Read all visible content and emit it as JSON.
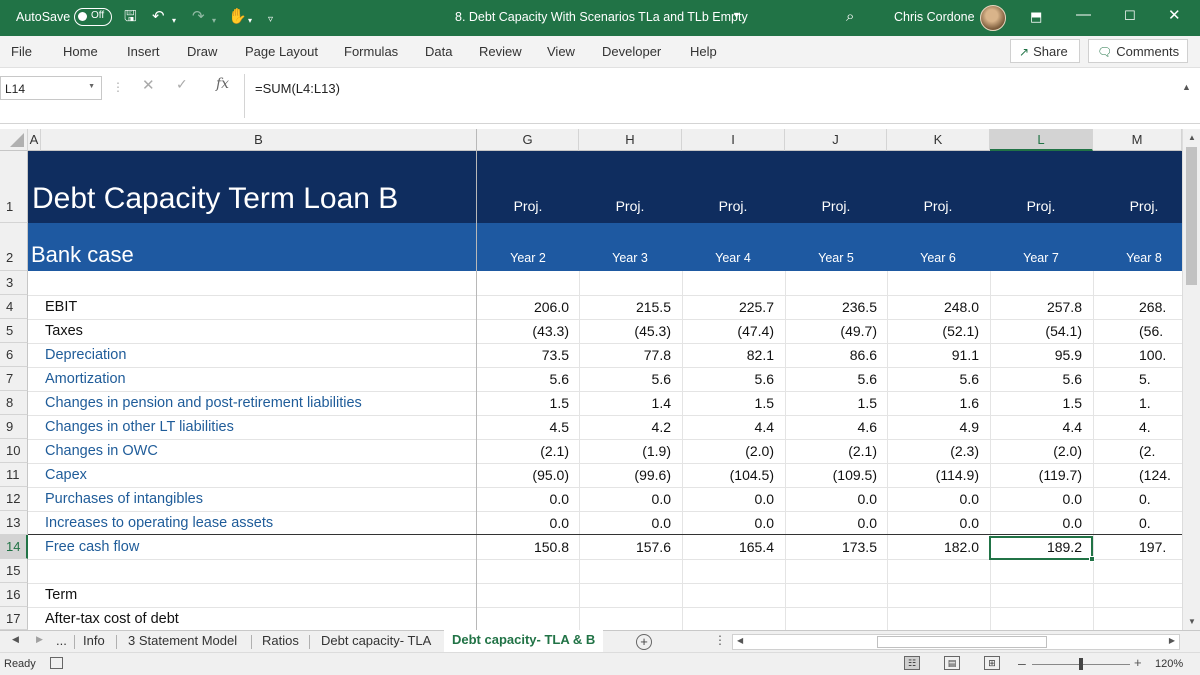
{
  "titlebar": {
    "autosave_label": "AutoSave",
    "autosave_state": "Off",
    "doc_title": "8. Debt Capacity With Scenarios TLa and TLb Empty",
    "user_name": "Chris Cordone",
    "bg_color": "#217346"
  },
  "ribbon": {
    "tabs": [
      "File",
      "Home",
      "Insert",
      "Draw",
      "Page Layout",
      "Formulas",
      "Data",
      "Review",
      "View",
      "Developer",
      "Help"
    ],
    "share_label": "Share",
    "comments_label": "Comments"
  },
  "formula_bar": {
    "name_box": "L14",
    "formula": "=SUM(L4:L13)"
  },
  "columns": [
    "A",
    "B",
    "G",
    "H",
    "I",
    "J",
    "K",
    "L",
    "M"
  ],
  "selected_column": "L",
  "row_numbers": [
    "1",
    "2",
    "3",
    "4",
    "5",
    "6",
    "7",
    "8",
    "9",
    "10",
    "11",
    "12",
    "13",
    "14",
    "15",
    "16",
    "17"
  ],
  "selected_row": "14",
  "sheet": {
    "title": "Debt Capacity Term Loan B",
    "subtitle": "Bank case",
    "proj_labels": [
      "Proj.",
      "Proj.",
      "Proj.",
      "Proj.",
      "Proj.",
      "Proj.",
      "Proj."
    ],
    "year_labels": [
      "Year 2",
      "Year 3",
      "Year 4",
      "Year 5",
      "Year 6",
      "Year 7",
      "Year 8"
    ],
    "header_band_colors": [
      "#0f2d5f",
      "#1e59a1"
    ],
    "rows": [
      {
        "label": "EBIT",
        "values": [
          "206.0",
          "215.5",
          "225.7",
          "236.5",
          "248.0",
          "257.8",
          "268."
        ]
      },
      {
        "label": "Taxes",
        "values": [
          "(43.3)",
          "(45.3)",
          "(47.4)",
          "(49.7)",
          "(52.1)",
          "(54.1)",
          "(56."
        ]
      },
      {
        "label": "Depreciation",
        "values": [
          "73.5",
          "77.8",
          "82.1",
          "86.6",
          "91.1",
          "95.9",
          "100."
        ]
      },
      {
        "label": "Amortization",
        "values": [
          "5.6",
          "5.6",
          "5.6",
          "5.6",
          "5.6",
          "5.6",
          "5."
        ]
      },
      {
        "label": "Changes in pension and post-retirement liabilities",
        "values": [
          "1.5",
          "1.4",
          "1.5",
          "1.5",
          "1.6",
          "1.5",
          "1."
        ]
      },
      {
        "label": "Changes in other LT liabilities",
        "values": [
          "4.5",
          "4.2",
          "4.4",
          "4.6",
          "4.9",
          "4.4",
          "4."
        ]
      },
      {
        "label": "Changes in OWC",
        "values": [
          "(2.1)",
          "(1.9)",
          "(2.0)",
          "(2.1)",
          "(2.3)",
          "(2.0)",
          "(2."
        ]
      },
      {
        "label": "Capex",
        "values": [
          "(95.0)",
          "(99.6)",
          "(104.5)",
          "(109.5)",
          "(114.9)",
          "(119.7)",
          "(124."
        ]
      },
      {
        "label": "Purchases of intangibles",
        "values": [
          "0.0",
          "0.0",
          "0.0",
          "0.0",
          "0.0",
          "0.0",
          "0."
        ]
      },
      {
        "label": "Increases to operating lease assets",
        "values": [
          "0.0",
          "0.0",
          "0.0",
          "0.0",
          "0.0",
          "0.0",
          "0."
        ]
      },
      {
        "label": "Free cash flow",
        "values": [
          "150.8",
          "157.6",
          "165.4",
          "173.5",
          "182.0",
          "189.2",
          "197."
        ]
      }
    ],
    "row15_label": "",
    "row16_label": "Term",
    "row17_label": "After-tax cost of debt"
  },
  "sheet_tabs": {
    "overflow": "...",
    "tabs": [
      "Info",
      "3 Statement Model",
      "Ratios",
      "Debt capacity- TLA",
      "Debt capacity- TLA & B"
    ],
    "active": "Debt capacity- TLA & B"
  },
  "status": {
    "ready": "Ready",
    "zoom": "120%"
  }
}
